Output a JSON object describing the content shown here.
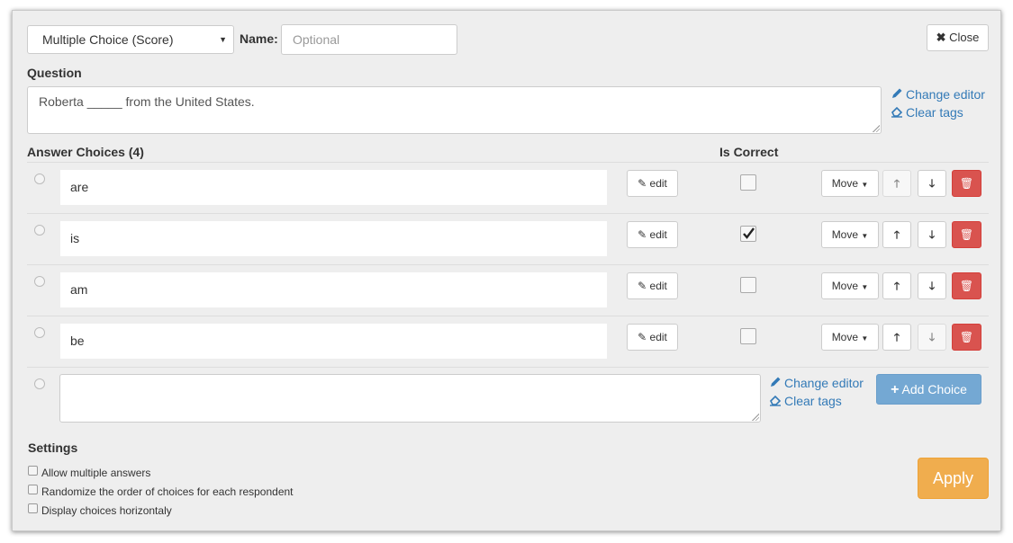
{
  "header": {
    "question_type": "Multiple Choice (Score)",
    "name_label": "Name:",
    "name_placeholder": "Optional",
    "close_label": "Close"
  },
  "question": {
    "label": "Question",
    "text": "Roberta _____ from the United States.",
    "change_editor": "Change editor",
    "clear_tags": "Clear tags"
  },
  "choices": {
    "header": "Answer Choices (4)",
    "is_correct_header": "Is Correct",
    "edit_label": "edit",
    "move_label": "Move",
    "items": [
      {
        "text": "are",
        "correct": false
      },
      {
        "text": "is",
        "correct": true
      },
      {
        "text": "am",
        "correct": false
      },
      {
        "text": "be",
        "correct": false
      }
    ],
    "new_choice": {
      "change_editor": "Change editor",
      "clear_tags": "Clear tags",
      "add_label": "Add Choice"
    }
  },
  "settings": {
    "label": "Settings",
    "options": [
      {
        "label": "Allow multiple answers",
        "checked": false
      },
      {
        "label": "Randomize the order of choices for each respondent",
        "checked": false
      },
      {
        "label": "Display choices horizontaly",
        "checked": false
      }
    ],
    "apply_label": "Apply"
  },
  "colors": {
    "link": "#337ab7",
    "delete": "#d9534f",
    "add": "#74a8d3",
    "apply": "#f0ad4e"
  }
}
